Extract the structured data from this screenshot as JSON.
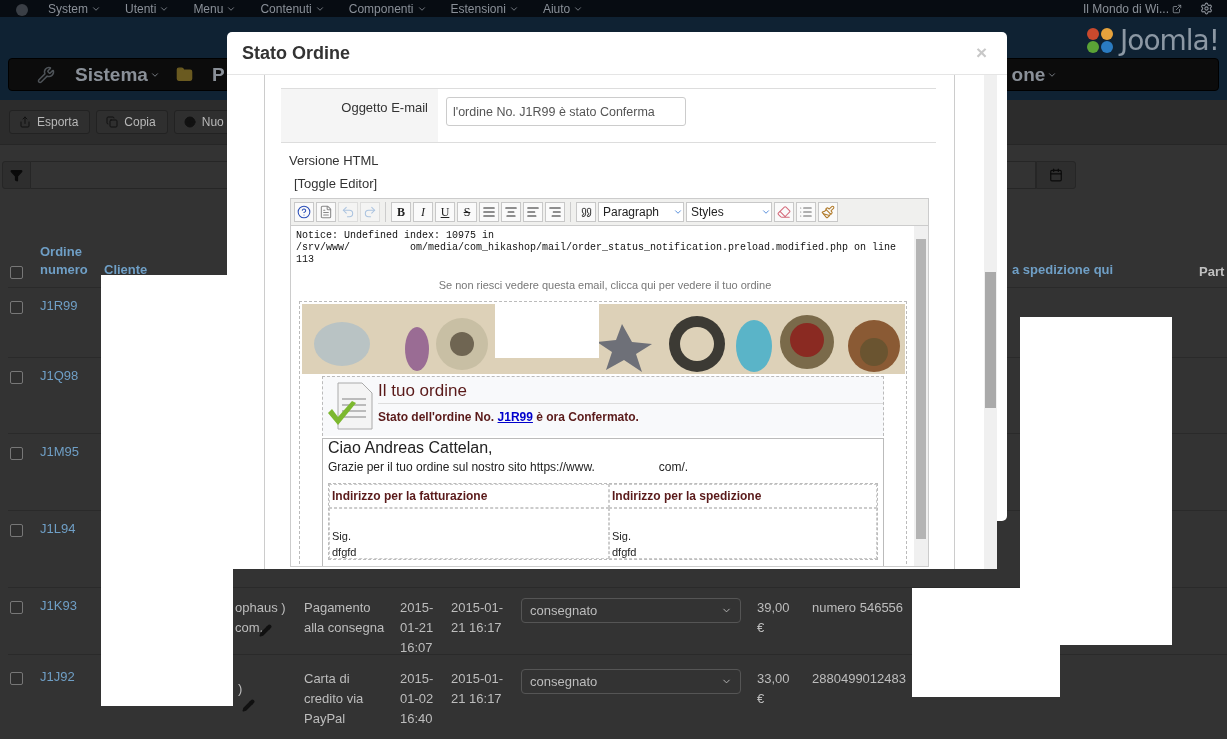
{
  "top_menu": {
    "items": [
      {
        "label": "System"
      },
      {
        "label": "Utenti"
      },
      {
        "label": "Menu"
      },
      {
        "label": "Contenuti"
      },
      {
        "label": "Componenti"
      },
      {
        "label": "Estensioni"
      },
      {
        "label": "Aiuto"
      }
    ],
    "site_link": "Il Mondo di Wi..."
  },
  "header": {
    "logo": "Joomla!",
    "menu_left": [
      "Sistema",
      "P"
    ],
    "menu_right": "one"
  },
  "toolbar": {
    "buttons": [
      {
        "kind": "export",
        "label": "Esporta"
      },
      {
        "kind": "copy",
        "label": "Copia"
      },
      {
        "kind": "new",
        "label": "Nuo"
      }
    ]
  },
  "table": {
    "select_all": {
      "checked": false
    },
    "header": {
      "order": "Ordine numero",
      "customer": "Cliente",
      "shipping": "a spedizione qui",
      "partner": "Part"
    },
    "rows": [
      {
        "order": "J1R99",
        "checked": false
      },
      {
        "order": "J1Q98",
        "checked": false
      },
      {
        "order": "J1M95",
        "checked": false
      },
      {
        "order": "J1L94",
        "checked": false
      },
      {
        "order": "J1K93",
        "checked": false,
        "customer": [
          "ophaus )",
          "com,"
        ],
        "payment": "Pagamento alla consegna",
        "created": "2015-01-21 16:07",
        "modified": "2015-01-21 16:17",
        "status": "consegnato",
        "total": "39,00 €",
        "tracking": "numero 546556"
      },
      {
        "order": "J1J92",
        "checked": false,
        "customer": [
          ")"
        ],
        "payment": "Carta di credito via PayPal",
        "created": "2015-01-02 16:40",
        "modified": "2015-01-21 16:17",
        "status": "consegnato",
        "total": "33,00 €",
        "tracking": "2880499012483"
      }
    ]
  },
  "modal": {
    "title": "Stato Ordine",
    "close": "×",
    "subject_label": "Oggetto E-mail",
    "subject_value": "l'ordine No. J1R99 è stato Conferma",
    "html_label": "Versione HTML",
    "toggle": "[Toggle Editor]",
    "editor_tools": [
      {
        "kind": "help",
        "disabled": false
      },
      {
        "kind": "new_doc",
        "disabled": false
      },
      {
        "kind": "undo",
        "disabled": true
      },
      {
        "kind": "redo",
        "disabled": true
      },
      {
        "kind": "separator"
      },
      {
        "kind": "bold",
        "label": "B",
        "disabled": false
      },
      {
        "kind": "italic",
        "label": "I",
        "disabled": false
      },
      {
        "kind": "underline",
        "label": "U",
        "disabled": false
      },
      {
        "kind": "strike",
        "label": "S",
        "disabled": false
      },
      {
        "kind": "justify",
        "disabled": false
      },
      {
        "kind": "center",
        "disabled": false
      },
      {
        "kind": "left",
        "disabled": false
      },
      {
        "kind": "right",
        "disabled": false
      },
      {
        "kind": "separator"
      },
      {
        "kind": "quote",
        "disabled": false
      },
      {
        "kind": "select",
        "label": "Paragraph",
        "disabled": false
      },
      {
        "kind": "select",
        "label": "Styles",
        "disabled": false
      },
      {
        "kind": "eraser",
        "disabled": false
      },
      {
        "kind": "table",
        "disabled": false
      },
      {
        "kind": "broom",
        "disabled": false
      }
    ],
    "email": {
      "notice_line": "Notice: Undefined index: 10975 in",
      "notice_path": [
        "/srv/www/",
        "om/media/com_hikashop/mail/order_status_notification.preload.modified.php on line"
      ],
      "notice_end": "113",
      "view_link": "Se non riesci vedere questa email, clicca qui per vedere il tuo ordine",
      "order_title": "Il tuo ordine",
      "status_text": {
        "before": "Stato dell'ordine No.",
        "link": "J1R99",
        "after": "è ora Confermato."
      },
      "greeting": "Ciao Andreas Cattelan,",
      "thanks": [
        "Grazie per il tuo ordine sul nostro sito https://www.",
        "com/."
      ],
      "addresses": [
        {
          "title": "Indirizzo per la fatturazione",
          "lines": [
            "Sig.",
            "dfgfd"
          ]
        },
        {
          "title": "Indirizzo per la spedizione",
          "lines": [
            "Sig.",
            "dfgfd"
          ]
        }
      ]
    }
  }
}
